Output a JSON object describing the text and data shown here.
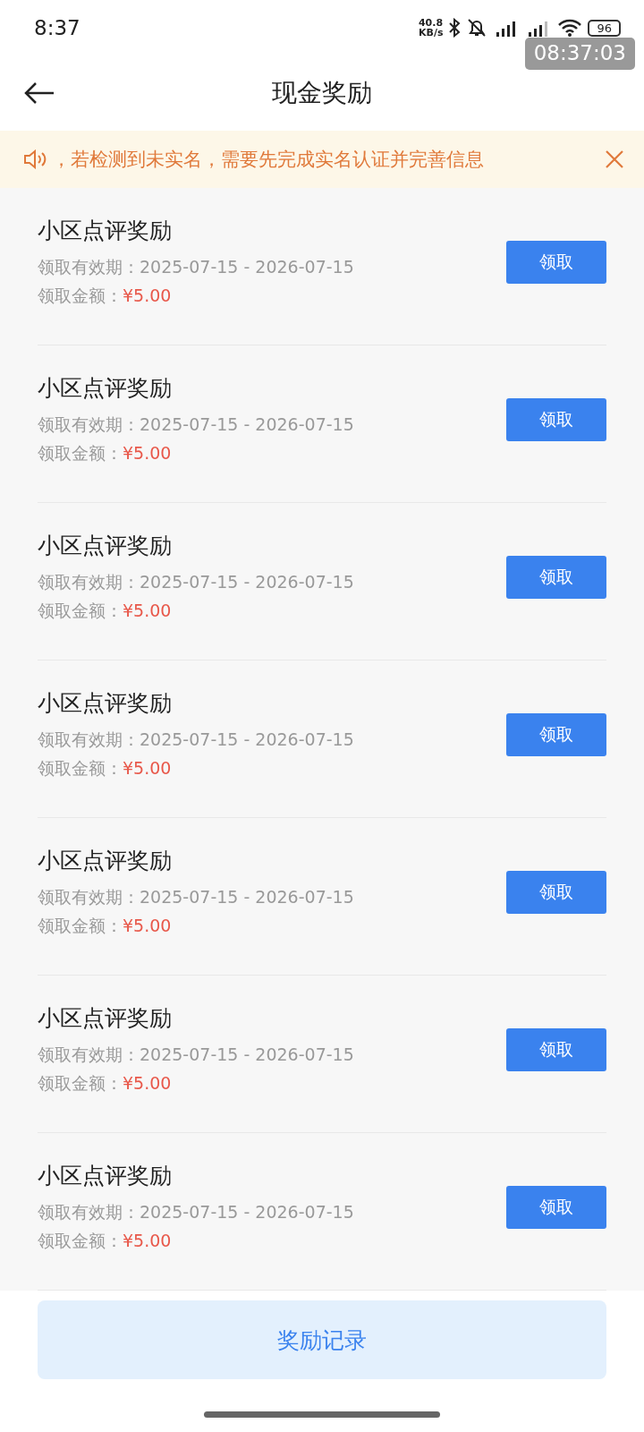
{
  "status_bar": {
    "time": "8:37",
    "net_speed_value": "40.8",
    "net_speed_unit": "KB/s",
    "battery": "96"
  },
  "recording_clock": "08:37:03",
  "header": {
    "title": "现金奖励"
  },
  "notice": {
    "text": "，若检测到未实名，需要先完成实名认证并完善信息"
  },
  "rewards": [
    {
      "title": "小区点评奖励",
      "validity_label": "领取有效期：",
      "validity": "2025-07-15 - 2026-07-15",
      "amount_label": "领取金额：",
      "amount": "¥5.00",
      "button": "领取"
    },
    {
      "title": "小区点评奖励",
      "validity_label": "领取有效期：",
      "validity": "2025-07-15 - 2026-07-15",
      "amount_label": "领取金额：",
      "amount": "¥5.00",
      "button": "领取"
    },
    {
      "title": "小区点评奖励",
      "validity_label": "领取有效期：",
      "validity": "2025-07-15 - 2026-07-15",
      "amount_label": "领取金额：",
      "amount": "¥5.00",
      "button": "领取"
    },
    {
      "title": "小区点评奖励",
      "validity_label": "领取有效期：",
      "validity": "2025-07-15 - 2026-07-15",
      "amount_label": "领取金额：",
      "amount": "¥5.00",
      "button": "领取"
    },
    {
      "title": "小区点评奖励",
      "validity_label": "领取有效期：",
      "validity": "2025-07-15 - 2026-07-15",
      "amount_label": "领取金额：",
      "amount": "¥5.00",
      "button": "领取"
    },
    {
      "title": "小区点评奖励",
      "validity_label": "领取有效期：",
      "validity": "2025-07-15 - 2026-07-15",
      "amount_label": "领取金额：",
      "amount": "¥5.00",
      "button": "领取"
    },
    {
      "title": "小区点评奖励",
      "validity_label": "领取有效期：",
      "validity": "2025-07-15 - 2026-07-15",
      "amount_label": "领取金额：",
      "amount": "¥5.00",
      "button": "领取"
    }
  ],
  "footer_button": "奖励记录"
}
